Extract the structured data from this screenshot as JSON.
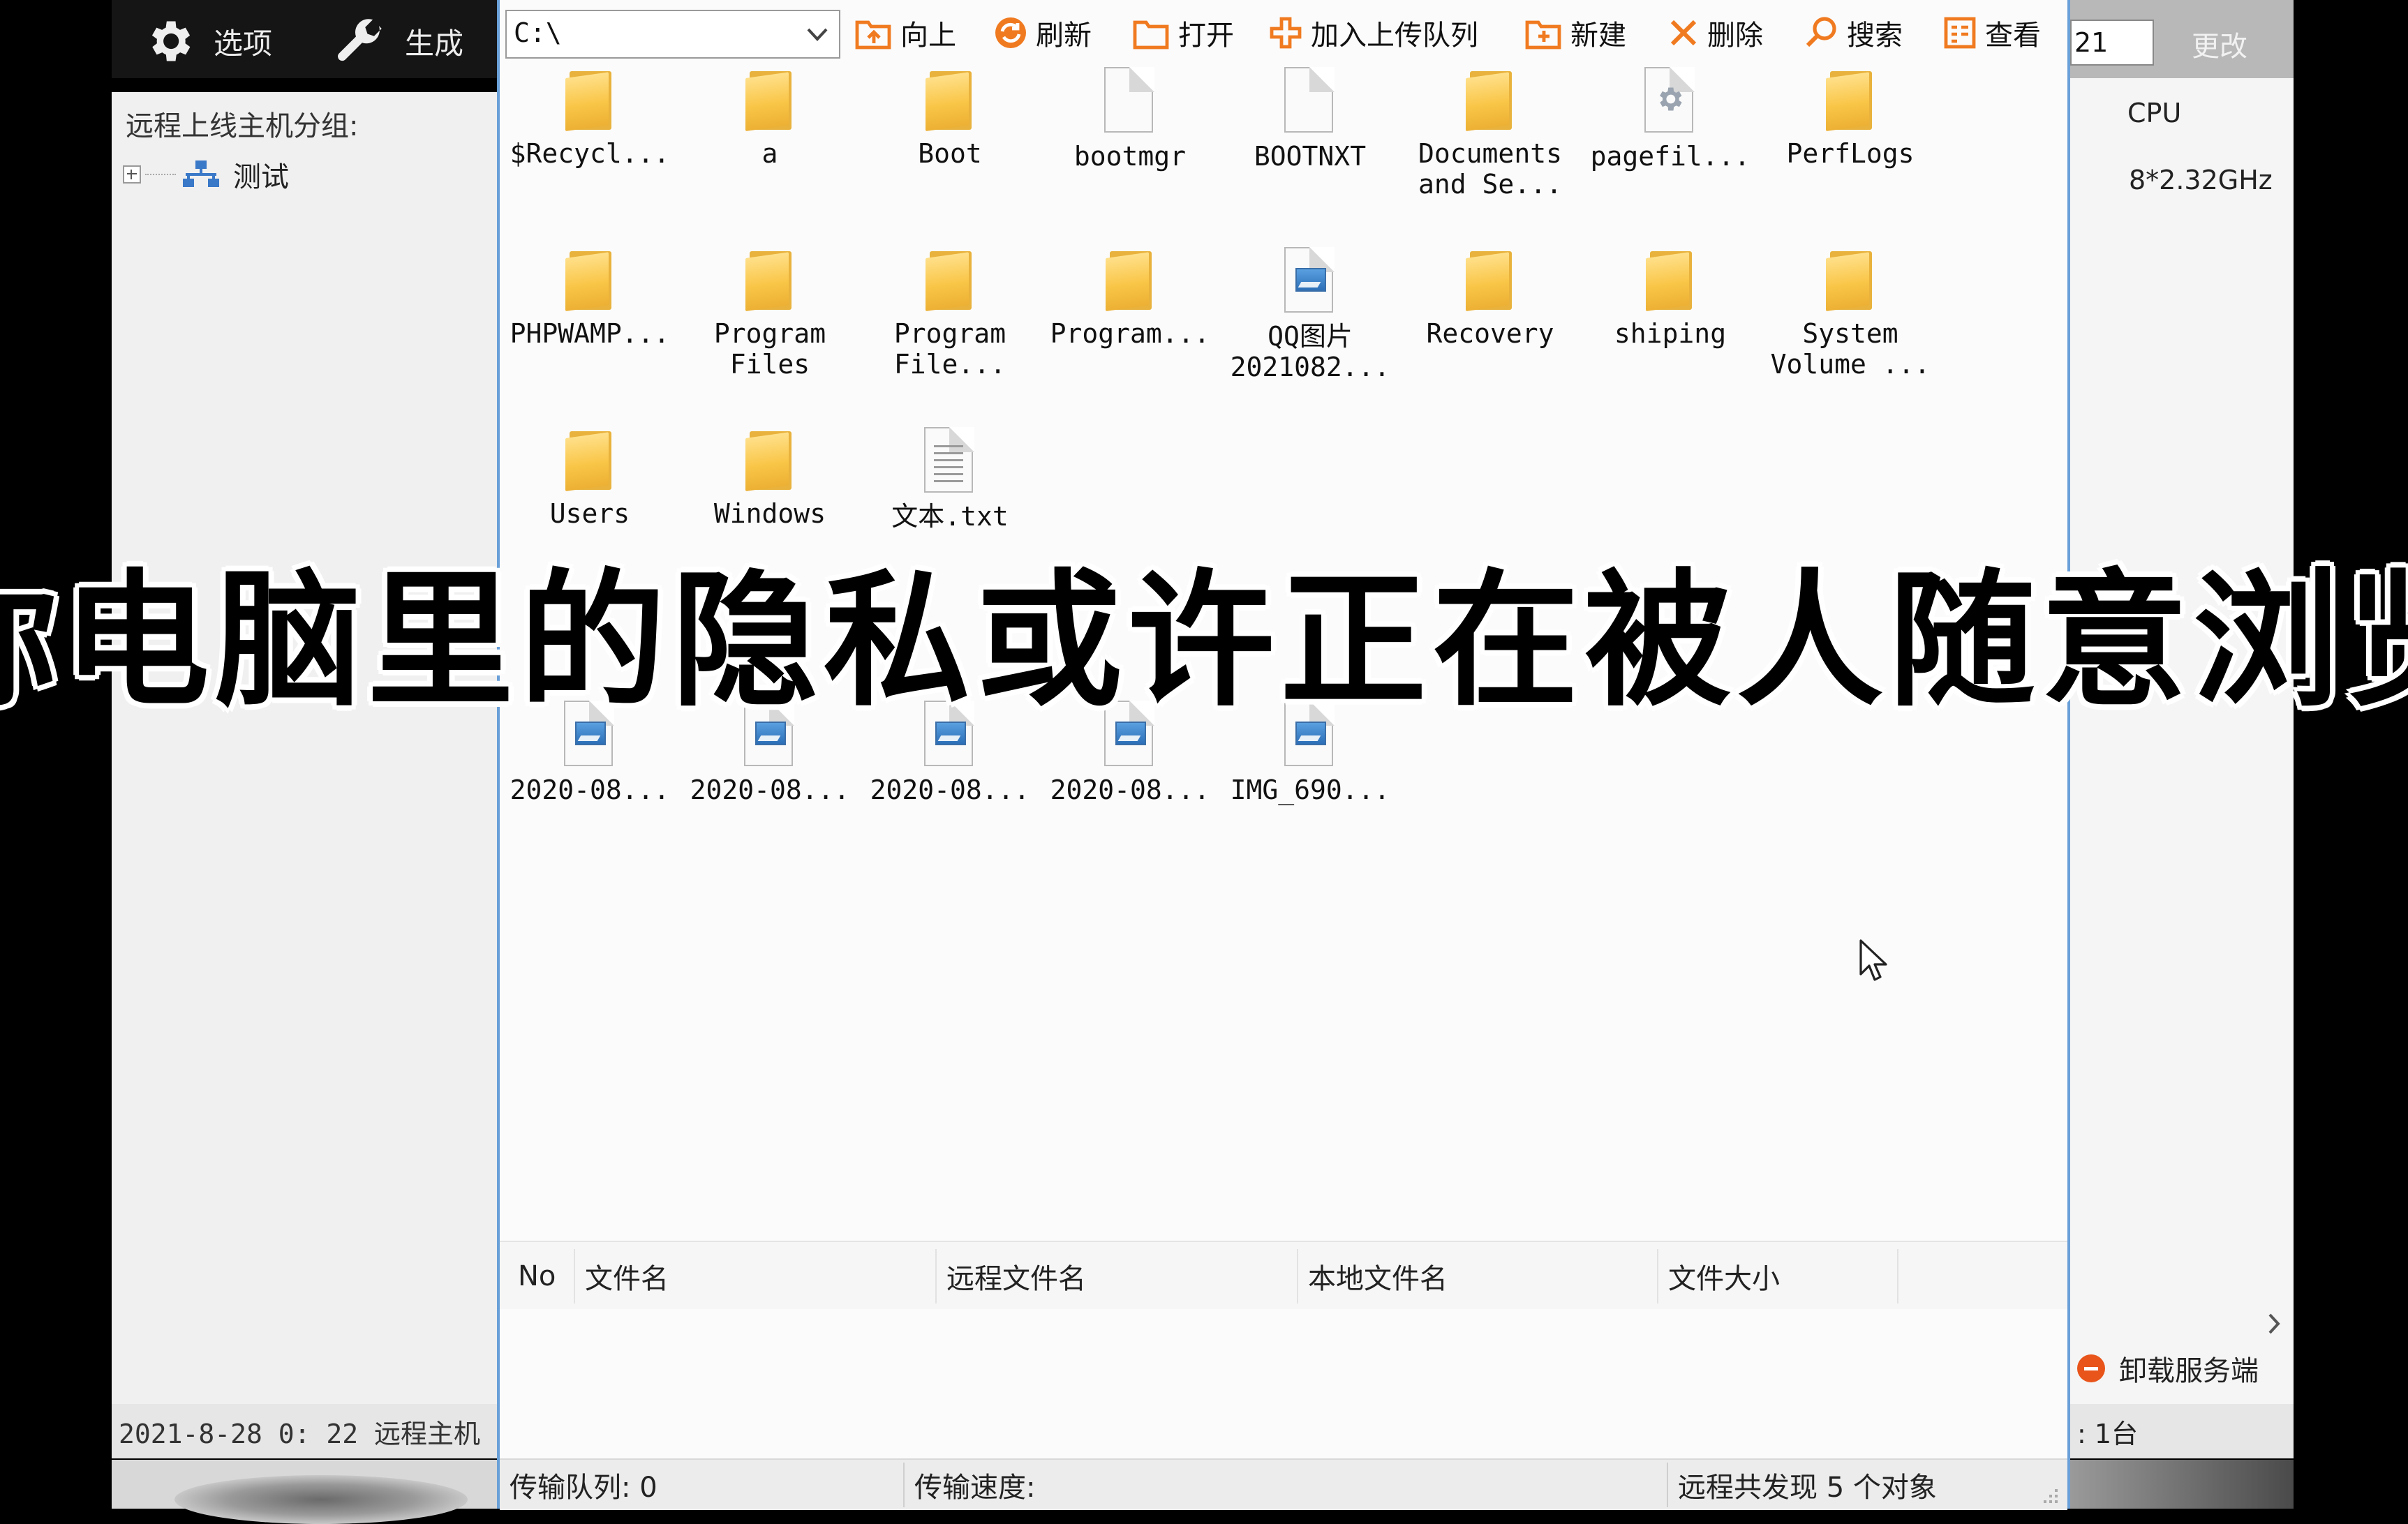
{
  "host": {
    "options_label": "选项",
    "build_label": "生成",
    "group_title": "远程上线主机分组:",
    "group_item": "测试",
    "status_left": "2021-8-28 0: 22 远程主机"
  },
  "dialog": {
    "path": "C:\\",
    "toolbar": {
      "up": "向上",
      "refresh": "刷新",
      "open": "打开",
      "upload_queue": "加入上传队列",
      "new": "新建",
      "delete": "删除",
      "search": "搜索",
      "view": "查看"
    },
    "files": [
      {
        "name": "$Recycl...",
        "icon": "folder"
      },
      {
        "name": "a",
        "icon": "folder"
      },
      {
        "name": "Boot",
        "icon": "folder"
      },
      {
        "name": "bootmgr",
        "icon": "file"
      },
      {
        "name": "BOOTNXT",
        "icon": "file"
      },
      {
        "name": "Documents\nand Se...",
        "icon": "folder"
      },
      {
        "name": "pagefil...",
        "icon": "system-file"
      },
      {
        "name": "PerfLogs",
        "icon": "folder"
      },
      {
        "name": "PHPWAMP...",
        "icon": "folder"
      },
      {
        "name": "Program\nFiles",
        "icon": "folder"
      },
      {
        "name": "Program\nFile...",
        "icon": "folder"
      },
      {
        "name": "Program...",
        "icon": "folder"
      },
      {
        "name": "QQ图片\n2021082...",
        "icon": "image"
      },
      {
        "name": "Recovery",
        "icon": "folder"
      },
      {
        "name": "shiping",
        "icon": "folder"
      },
      {
        "name": "System\nVolume ...",
        "icon": "folder"
      },
      {
        "name": "Users",
        "icon": "folder"
      },
      {
        "name": "Windows",
        "icon": "folder"
      },
      {
        "name": "文本.txt",
        "icon": "text"
      },
      {
        "name": "2020-08...",
        "icon": "image"
      },
      {
        "name": "2020-08...",
        "icon": "image"
      },
      {
        "name": "2020-08...",
        "icon": "image"
      },
      {
        "name": "2020-08...",
        "icon": "image"
      },
      {
        "name": "IMG_690...",
        "icon": "image"
      }
    ],
    "columns": [
      "No",
      "文件名",
      "远程文件名",
      "本地文件名",
      "文件大小"
    ],
    "status": {
      "queue": "传输队列:  0",
      "speed": "传输速度:",
      "found": "远程共发现  5  个对象"
    }
  },
  "right": {
    "input_value": "21",
    "change_label": "更改",
    "cpu_label": "CPU",
    "cpu_value": "8*2.32GHz",
    "unload_label": "卸载服务端",
    "count_label": ": 1台"
  },
  "caption": "你电脑里的隐私或许正在被人随意浏览"
}
